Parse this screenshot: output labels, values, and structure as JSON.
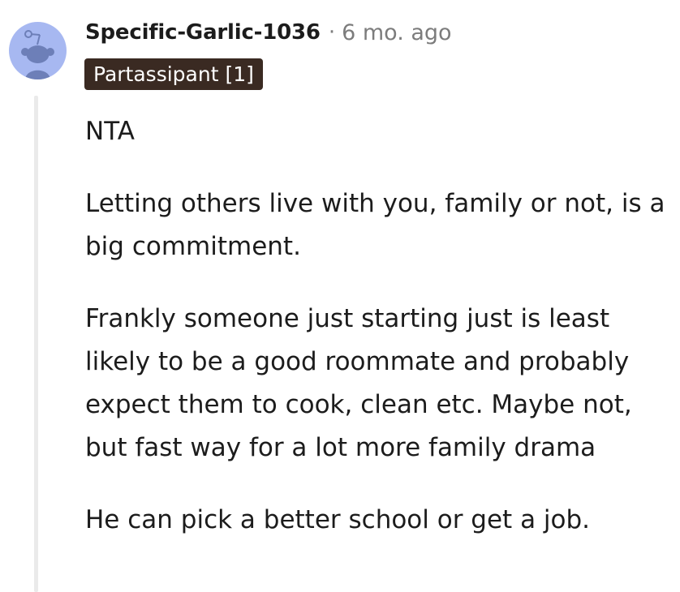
{
  "comment": {
    "username": "Specific-Garlic-1036",
    "separator": "·",
    "timestamp": "6 mo. ago",
    "flair": "Partassipant [1]",
    "avatar_color": "#a7b8f1",
    "flair_color": "#3a2a22",
    "paragraphs": [
      "NTA",
      "Letting others live with you, family or not, is a big commitment.",
      "Frankly someone just starting just is least likely to be a good roommate and probably expect them to cook, clean etc. Maybe not, but fast way for a lot more family drama",
      "He can pick a better school or get a job."
    ]
  }
}
